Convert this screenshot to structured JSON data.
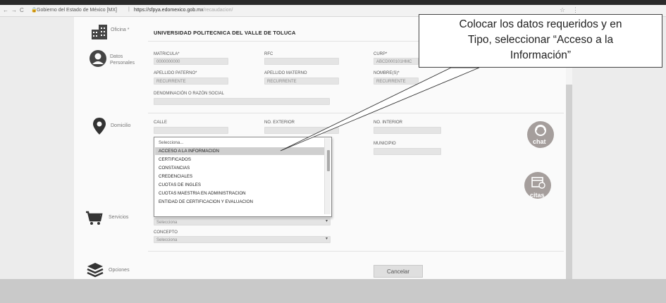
{
  "browser": {
    "site_label": "Gobierno del Estado de México [MX]",
    "url_host": "https://sfpya.edomexico.gob.mx",
    "url_path": "/recaudacion/"
  },
  "form": {
    "oficina_label": "Oficina *",
    "oficina_value": "UNIVERSIDAD POLITECNICA DEL VALLE DE TOLUCA",
    "datos_label_1": "Datos",
    "datos_label_2": "Personales",
    "matricula_label": "MATRICULA*",
    "matricula_value": "0000000000",
    "rfc_label": "RFC",
    "curp_label": "CURP*",
    "curp_value": "ABCD000101HMC",
    "apellido_paterno_label": "APELLIDO PATERNO*",
    "apellido_paterno_value": "RECURRENTE",
    "apellido_materno_label": "APELLIDO MATERNO",
    "apellido_materno_value": "RECURRENTE",
    "nombre_label": "NOMBRE(S)*",
    "nombre_value": "RECURRENTE",
    "denominacion_label": "DENOMINACIÓN O RAZÓN SOCIAL",
    "domicilio_label": "Domicilio",
    "calle_label": "CALLE",
    "no_exterior_label": "NO. EXTERIOR",
    "no_interior_label": "NO. INTERIOR",
    "municipio_label": "MUNICIPIO",
    "servicios_label": "Servicios",
    "tipo_value": "Selecciona",
    "concepto_label": "CONCEPTO",
    "concepto_value": "Selecciona",
    "opciones_label": "Opciones",
    "cancel_label": "Cancelar"
  },
  "dropdown": {
    "items": [
      "Selecciona...",
      "ACCESO A LA INFORMACION",
      "CERTIFICADOS",
      "CONSTANCIAS",
      "CREDENCIALES",
      "CUOTAS DE INGLES",
      "CUOTAS MAESTRIA EN ADMINISTRACION",
      "ENTIDAD DE CERTIFICACION Y EVALUACION"
    ],
    "selected_index": 1
  },
  "callout": {
    "line1": "Colocar los datos requeridos y en",
    "line2": "Tipo, seleccionar “Acceso a la",
    "line3": "Información”"
  },
  "side_buttons": {
    "chat_label": "chat",
    "citas_label": "citas"
  }
}
